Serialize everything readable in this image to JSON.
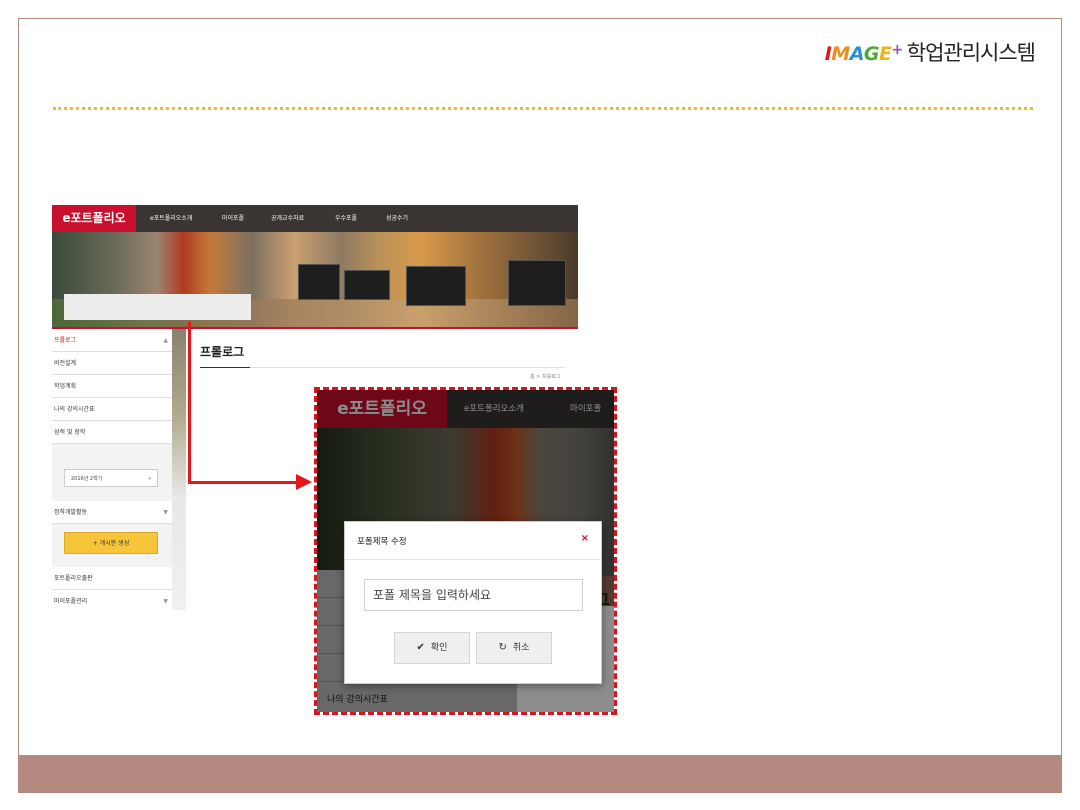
{
  "header": {
    "logo_letters": [
      "I",
      "M",
      "A",
      "G",
      "E",
      "+"
    ],
    "logo_colors": [
      "#e8151a",
      "#f08c1a",
      "#2a8fd8",
      "#4aaa3a",
      "#f0b41a",
      "#9a4ac8"
    ],
    "title": "학업관리시스템"
  },
  "colors": {
    "accent": "#c8102e",
    "footer": "#b48a80",
    "dotted_rule": "#e6b94a",
    "arrow": "#e8151a"
  },
  "screenshot_small": {
    "logo": "e포트폴리오",
    "nav": [
      "e포트폴리오소개",
      "마이포폴",
      "공개교수자료",
      "우수포폴",
      "성공수기"
    ],
    "sidebar": {
      "items": [
        "프롤로그",
        "비전설계",
        "학업계획",
        "나의 강의시간표",
        "성적 및 장학"
      ],
      "semester_select": "2016년 2학기",
      "item_after_select": "정착개발활동",
      "add_button": "+ 게시판 생성",
      "bottom_items": [
        "포트폴리오출판",
        "마이포폴관리"
      ]
    },
    "page_title": "프롤로그",
    "breadcrumb": "홈 > 프롤로그"
  },
  "screenshot_zoom": {
    "logo": "e포트폴리오",
    "nav": [
      "e포트폴리오소개",
      "마이포폴"
    ],
    "title_fragment": "그",
    "sidebar_label": "나의 강의시간표",
    "modal": {
      "title": "포폴제목 수정",
      "close_icon": "×",
      "input_placeholder": "포폴 제목을 입력하세요",
      "confirm_label": "확인",
      "cancel_label": "취소"
    }
  }
}
